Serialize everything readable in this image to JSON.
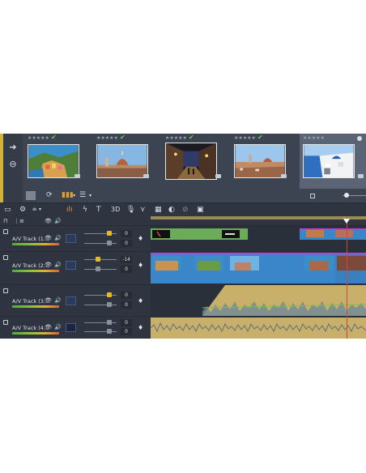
{
  "library": {
    "nav_icons": [
      "arrow-right-icon",
      "back-icon"
    ],
    "thumbnails": [
      {
        "stars": "★★★★★",
        "checked": true,
        "name": "coastal-village-thumbnail"
      },
      {
        "stars": "★★★★★",
        "checked": true,
        "name": "florence-dome-thumbnail"
      },
      {
        "stars": "★★★★★",
        "checked": true,
        "name": "night-street-thumbnail"
      },
      {
        "stars": "★★★★★",
        "checked": true,
        "name": "city-panorama-thumbnail"
      },
      {
        "stars": "★★★★★",
        "checked": false,
        "name": "santorini-thumbnail",
        "selected": true
      }
    ]
  },
  "toolbar": {
    "icons": [
      "storyboard-icon",
      "snap-icon",
      "razor-icon",
      "title-icon",
      "3d-icon",
      "voiceover-icon",
      "transition-icon",
      "chapter-icon",
      "color-icon",
      "link-icon",
      "film-icon"
    ]
  },
  "tracks": [
    {
      "name": "A/V Track (1...",
      "volume": "0",
      "pan": "0",
      "meter_level": 0.95
    },
    {
      "name": "A/V Track (2...",
      "volume": "-14",
      "pan": "0",
      "meter_level": 0.9
    },
    {
      "name": "A/V Track (3...",
      "volume": "0",
      "pan": "0",
      "meter_level": 0.9
    },
    {
      "name": "A/V Track (4...",
      "volume": "0",
      "pan": "0",
      "meter_level": 0.9
    }
  ],
  "colors": {
    "accent": "#d4b23a",
    "video_clip": "#3a86c8",
    "audio_clip": "#c9b06a",
    "title_clip": "#6cab57",
    "magenta_marker": "#c73bd6"
  }
}
